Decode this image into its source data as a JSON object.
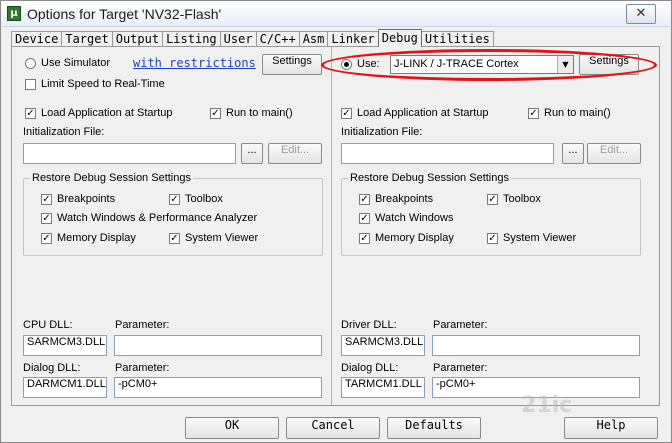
{
  "window": {
    "title": "Options for Target 'NV32-Flash'",
    "app_icon_glyph": "µ",
    "close_glyph": "✕"
  },
  "tabs": [
    {
      "label": "Device",
      "active": false
    },
    {
      "label": "Target",
      "active": false
    },
    {
      "label": "Output",
      "active": false
    },
    {
      "label": "Listing",
      "active": false
    },
    {
      "label": "User",
      "active": false
    },
    {
      "label": "C/C++",
      "active": false
    },
    {
      "label": "Asm",
      "active": false
    },
    {
      "label": "Linker",
      "active": false
    },
    {
      "label": "Debug",
      "active": true
    },
    {
      "label": "Utilities",
      "active": false
    }
  ],
  "left": {
    "use_simulator_label": "Use Simulator",
    "restrictions_link": "with restrictions",
    "settings_label": "Settings",
    "limit_speed_label": "Limit Speed to Real-Time",
    "load_app_label": "Load Application at Startup",
    "run_to_main_label": "Run to main()",
    "init_file_label": "Initialization File:",
    "init_file_value": "",
    "browse_label": "...",
    "edit_label": "Edit...",
    "restore_group_title": "Restore Debug Session Settings",
    "breakpoints_label": "Breakpoints",
    "toolbox_label": "Toolbox",
    "watch_windows_label": "Watch Windows & Performance Analyzer",
    "memory_display_label": "Memory Display",
    "system_viewer_label": "System Viewer",
    "cpu_dll_label": "CPU DLL:",
    "cpu_dll_value": "SARMCM3.DLL",
    "cpu_param_label": "Parameter:",
    "cpu_param_value": "",
    "dialog_dll_label": "Dialog DLL:",
    "dialog_dll_value": "DARMCM1.DLL",
    "dialog_param_label": "Parameter:",
    "dialog_param_value": "-pCM0+"
  },
  "right": {
    "use_label": "Use:",
    "debugger_value": "J-LINK / J-TRACE Cortex",
    "dropdown_glyph": "▼",
    "settings_label": "Settings",
    "load_app_label": "Load Application at Startup",
    "run_to_main_label": "Run to main()",
    "init_file_label": "Initialization File:",
    "init_file_value": "",
    "browse_label": "...",
    "edit_label": "Edit...",
    "restore_group_title": "Restore Debug Session Settings",
    "breakpoints_label": "Breakpoints",
    "toolbox_label": "Toolbox",
    "watch_windows_label": "Watch Windows",
    "memory_display_label": "Memory Display",
    "system_viewer_label": "System Viewer",
    "driver_dll_label": "Driver DLL:",
    "driver_dll_value": "SARMCM3.DLL",
    "driver_param_label": "Parameter:",
    "driver_param_value": "",
    "dialog_dll_label": "Dialog DLL:",
    "dialog_dll_value": "TARMCM1.DLL",
    "dialog_param_label": "Parameter:",
    "dialog_param_value": "-pCM0+"
  },
  "check_glyph": "✓",
  "footer": {
    "ok_label": "OK",
    "cancel_label": "Cancel",
    "defaults_label": "Defaults",
    "help_label": "Help"
  },
  "watermark_text": "21ic"
}
